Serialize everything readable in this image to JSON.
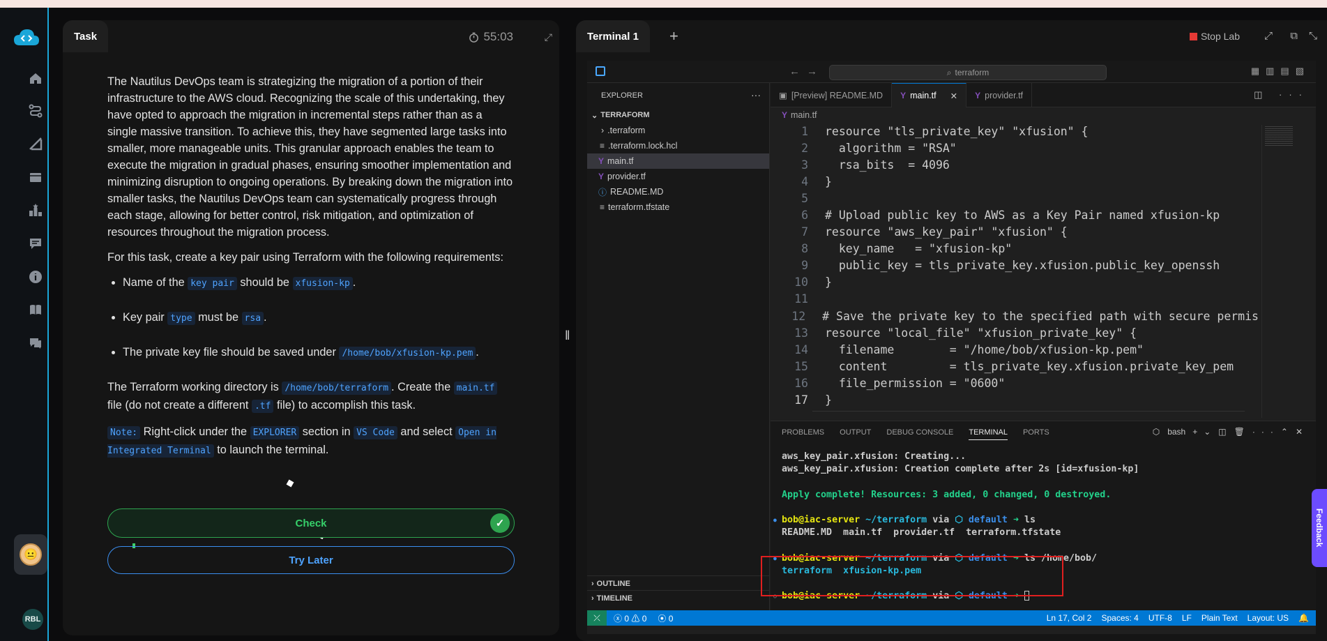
{
  "task_panel": {
    "tab_label": "Task",
    "timer": "55:03",
    "para1": "The Nautilus DevOps team is strategizing the migration of a portion of their infrastructure to the AWS cloud. Recognizing the scale of this undertaking, they have opted to approach the migration in incremental steps rather than as a single massive transition. To achieve this, they have segmented large tasks into smaller, more manageable units. This granular approach enables the team to execute the migration in gradual phases, ensuring smoother implementation and minimizing disruption to ongoing operations. By breaking down the migration into smaller tasks, the Nautilus DevOps team can systematically progress through each stage, allowing for better control, risk mitigation, and optimization of resources throughout the migration process.",
    "para2": "For this task, create a key pair using Terraform with the following requirements:",
    "req1": {
      "pre": "Name of the ",
      "code1": "key pair",
      "mid": " should be ",
      "code2": "xfusion-kp",
      "post": "."
    },
    "req2": {
      "pre": "Key pair ",
      "code1": "type",
      "mid": " must be ",
      "code2": "rsa",
      "post": "."
    },
    "req3": {
      "pre": "The private key file should be saved under ",
      "code1": "/home/bob/xfusion-kp.pem",
      "post": "."
    },
    "para3": {
      "pre": "The Terraform working directory is ",
      "code1": "/home/bob/terraform",
      "mid": ". Create the ",
      "code2": "main.tf",
      "mid2": " file (do not create a different ",
      "code3": ".tf",
      "post": " file) to accomplish this task."
    },
    "note": {
      "label": "Note:",
      "pre": " Right-click under the ",
      "code1": "EXPLORER",
      "mid": " section in ",
      "code2": "VS Code",
      "mid2": " and select ",
      "code3": "Open in Integrated Terminal",
      "post": " to launch the terminal."
    },
    "check_label": "Check",
    "later_label": "Try Later"
  },
  "rail": {
    "user_initials": "RBL"
  },
  "terminal_panel": {
    "tab_label": "Terminal 1",
    "stop_label": "Stop Lab"
  },
  "vscode": {
    "search": "terraform",
    "explorer_title": "EXPLORER",
    "folder": "TERRAFORM",
    "files": [
      ".terraform",
      ".terraform.lock.hcl",
      "main.tf",
      "provider.tf",
      "README.MD",
      "terraform.tfstate"
    ],
    "outline": "OUTLINE",
    "timeline": "TIMELINE",
    "tabs": [
      "[Preview] README.MD",
      "main.tf",
      "provider.tf"
    ],
    "breadcrumb": "main.tf",
    "code_lines": [
      "resource \"tls_private_key\" \"xfusion\" {",
      "  algorithm = \"RSA\"",
      "  rsa_bits  = 4096",
      "}",
      "",
      "# Upload public key to AWS as a Key Pair named xfusion-kp",
      "resource \"aws_key_pair\" \"xfusion\" {",
      "  key_name   = \"xfusion-kp\"",
      "  public_key = tls_private_key.xfusion.public_key_openssh",
      "}",
      "",
      "# Save the private key to the specified path with secure permis",
      "resource \"local_file\" \"xfusion_private_key\" {",
      "  filename        = \"/home/bob/xfusion-kp.pem\"",
      "  content         = tls_private_key.xfusion.private_key_pem",
      "  file_permission = \"0600\"",
      "}"
    ],
    "panel_tabs": [
      "PROBLEMS",
      "OUTPUT",
      "DEBUG CONSOLE",
      "TERMINAL",
      "PORTS"
    ],
    "shell": "bash",
    "terminal": {
      "l1": "aws_key_pair.xfusion: Creating...",
      "l2": "aws_key_pair.xfusion: Creation complete after 2s [id=xfusion-kp]",
      "l3": "Apply complete! Resources: 3 added, 0 changed, 0 destroyed.",
      "user": "bob",
      "host": "iac-server",
      "path": "~/terraform",
      "via": "via",
      "env": "default",
      "cmd1": "ls",
      "out1": "README.MD  main.tf  provider.tf  terraform.tfstate",
      "cmd2": "ls /home/bob/",
      "out2": "terraform  xfusion-kp.pem"
    },
    "status": {
      "errors": "0",
      "warnings": "0",
      "ports": "0",
      "position": "Ln 17, Col 2",
      "spaces": "Spaces: 4",
      "encoding": "UTF-8",
      "eol": "LF",
      "lang": "Plain Text",
      "layout": "Layout: US"
    }
  },
  "feedback_label": "Feedback",
  "colors": {
    "accent": "#0078d4",
    "check_green": "#2ea44f",
    "link_blue": "#3b8ef0",
    "highlight_red": "#e01f1f"
  }
}
